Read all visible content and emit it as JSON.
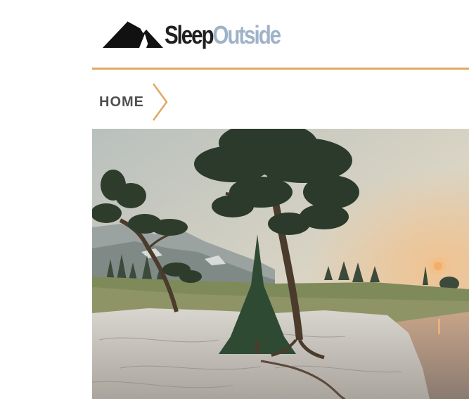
{
  "header": {
    "logo_text_part1": "Sleep",
    "logo_text_part2": "Outside"
  },
  "breadcrumb": {
    "home_label": "HOME"
  },
  "colors": {
    "accent": "#e0a863",
    "logo_dark": "#1f1f1f",
    "logo_light": "#9fb3c8",
    "breadcrumb_text": "#505050"
  },
  "hero": {
    "icon": "landscape-photo"
  }
}
